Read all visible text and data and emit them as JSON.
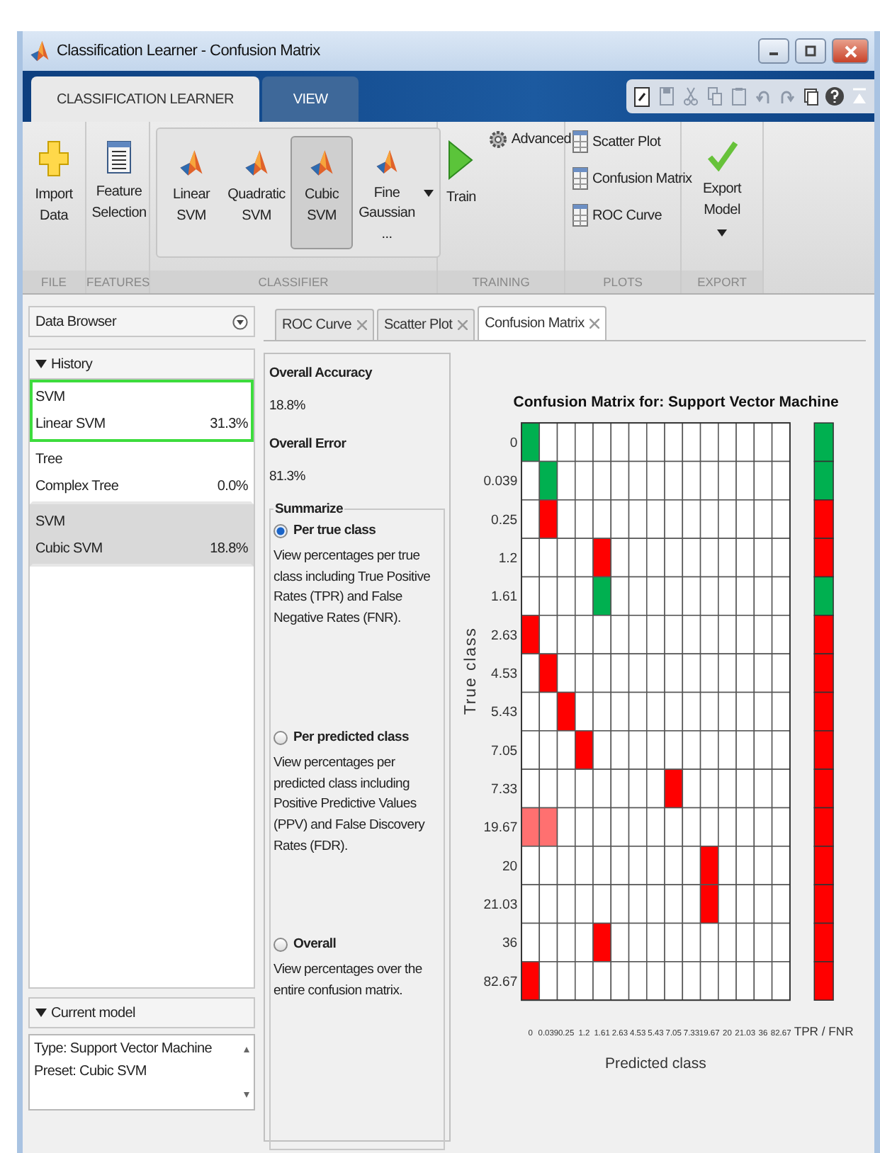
{
  "window": {
    "title": "Classification Learner - Confusion Matrix"
  },
  "ribbon_tabs": [
    {
      "label": "CLASSIFICATION LEARNER",
      "selected": true
    },
    {
      "label": "VIEW",
      "selected": false
    }
  ],
  "ribbon_sections": [
    {
      "label": "FILE",
      "kind": "large",
      "items": [
        {
          "kind": "import",
          "label": "Import Data"
        }
      ]
    },
    {
      "label": "FEATURES",
      "kind": "large",
      "items": [
        {
          "kind": "feature",
          "label": "Feature Selection"
        }
      ]
    },
    {
      "label": "CLASSIFIER",
      "kind": "gallery",
      "items": [
        {
          "kind": "model",
          "label": "Linear SVM",
          "selected": false
        },
        {
          "kind": "model",
          "label": "Quadratic SVM",
          "selected": false
        },
        {
          "kind": "model",
          "label": "Cubic SVM",
          "selected": true
        },
        {
          "kind": "model",
          "label": "Fine Gaussian ...",
          "selected": false
        }
      ]
    },
    {
      "label": "TRAINING",
      "kind": "training",
      "items": [
        {
          "kind": "train",
          "label": "Train"
        },
        {
          "kind": "advanced",
          "label": "Advanced"
        }
      ]
    },
    {
      "label": "PLOTS",
      "kind": "list",
      "items": [
        {
          "kind": "plot",
          "label": "Scatter Plot"
        },
        {
          "kind": "plot",
          "label": "Confusion Matrix"
        },
        {
          "kind": "plot",
          "label": "ROC Curve"
        }
      ]
    },
    {
      "label": "EXPORT",
      "kind": "large",
      "items": [
        {
          "kind": "export",
          "label": "Export Model"
        }
      ]
    }
  ],
  "data_browser": {
    "title": "Data Browser",
    "history": {
      "title": "History",
      "expanded": true,
      "items": [
        {
          "type": "SVM",
          "model": "Linear SVM",
          "accuracy": "31.3%",
          "selected": true,
          "current": false
        },
        {
          "type": "Tree",
          "model": "Complex Tree",
          "accuracy": "0.0%",
          "selected": false,
          "current": false
        },
        {
          "type": "SVM",
          "model": "Cubic SVM",
          "accuracy": "18.8%",
          "selected": false,
          "current": true
        }
      ]
    },
    "current_model": {
      "title": "Current model",
      "expanded": true,
      "lines": [
        "Type: Support Vector Machine",
        "Preset: Cubic SVM"
      ]
    }
  },
  "plot_tabs": [
    {
      "label": "ROC Curve",
      "selected": false
    },
    {
      "label": "Scatter Plot",
      "selected": false
    },
    {
      "label": "Confusion Matrix",
      "selected": true
    }
  ],
  "summary": {
    "accuracy_label": "Overall Accuracy",
    "accuracy": "18.8%",
    "error_label": "Overall Error",
    "error": "81.3%"
  },
  "summarize": {
    "title": "Summarize",
    "options": [
      {
        "label": "Per true class",
        "description": "View percentages per true class including True Positive Rates (TPR) and False Negative Rates (FNR).",
        "selected": true
      },
      {
        "label": "Per predicted class",
        "description": "View percentages per predicted class including Positive Predictive Values (PPV) and False Discovery Rates (FDR).",
        "selected": false
      },
      {
        "label": "Overall",
        "description": "View percentages over the entire confusion matrix.",
        "selected": false
      }
    ]
  },
  "confusion_matrix": {
    "title": "Confusion Matrix for: Support Vector Machine",
    "ylabel": "True class",
    "xlabel": "Predicted class",
    "summary_label": "TPR / FNR",
    "row_labels": [
      "0",
      "0.039",
      "0.25",
      "1.2",
      "1.61",
      "2.63",
      "4.53",
      "5.43",
      "7.05",
      "7.33",
      "19.67",
      "20",
      "21.03",
      "36",
      "82.67"
    ],
    "column_labels": [
      "0",
      "0.039",
      "0.25",
      "1.2",
      "1.61",
      "2.63",
      "4.53",
      "5.43",
      "7.05",
      "7.33",
      "19.67",
      "20",
      "21.03",
      "36",
      "82.67"
    ],
    "rows": [
      {
        "cells": [
          {
            "color": "#00b050"
          },
          {
            "color": "#ffffff"
          },
          {
            "color": "#ffffff"
          },
          {
            "color": "#ffffff"
          },
          {
            "color": "#ffffff"
          },
          {
            "color": "#ffffff"
          },
          {
            "color": "#ffffff"
          },
          {
            "color": "#ffffff"
          },
          {
            "color": "#ffffff"
          },
          {
            "color": "#ffffff"
          },
          {
            "color": "#ffffff"
          },
          {
            "color": "#ffffff"
          },
          {
            "color": "#ffffff"
          },
          {
            "color": "#ffffff"
          },
          {
            "color": "#ffffff"
          }
        ],
        "rate_cell": {
          "color": "#00b050"
        }
      },
      {
        "cells": [
          {
            "color": "#ffffff"
          },
          {
            "color": "#00b050"
          },
          {
            "color": "#ffffff"
          },
          {
            "color": "#ffffff"
          },
          {
            "color": "#ffffff"
          },
          {
            "color": "#ffffff"
          },
          {
            "color": "#ffffff"
          },
          {
            "color": "#ffffff"
          },
          {
            "color": "#ffffff"
          },
          {
            "color": "#ffffff"
          },
          {
            "color": "#ffffff"
          },
          {
            "color": "#ffffff"
          },
          {
            "color": "#ffffff"
          },
          {
            "color": "#ffffff"
          },
          {
            "color": "#ffffff"
          }
        ],
        "rate_cell": {
          "color": "#00b050"
        }
      },
      {
        "cells": [
          {
            "color": "#ffffff"
          },
          {
            "color": "#ff0000"
          },
          {
            "color": "#ffffff"
          },
          {
            "color": "#ffffff"
          },
          {
            "color": "#ffffff"
          },
          {
            "color": "#ffffff"
          },
          {
            "color": "#ffffff"
          },
          {
            "color": "#ffffff"
          },
          {
            "color": "#ffffff"
          },
          {
            "color": "#ffffff"
          },
          {
            "color": "#ffffff"
          },
          {
            "color": "#ffffff"
          },
          {
            "color": "#ffffff"
          },
          {
            "color": "#ffffff"
          },
          {
            "color": "#ffffff"
          }
        ],
        "rate_cell": {
          "color": "#ff0000"
        }
      },
      {
        "cells": [
          {
            "color": "#ffffff"
          },
          {
            "color": "#ffffff"
          },
          {
            "color": "#ffffff"
          },
          {
            "color": "#ffffff"
          },
          {
            "color": "#ff0000"
          },
          {
            "color": "#ffffff"
          },
          {
            "color": "#ffffff"
          },
          {
            "color": "#ffffff"
          },
          {
            "color": "#ffffff"
          },
          {
            "color": "#ffffff"
          },
          {
            "color": "#ffffff"
          },
          {
            "color": "#ffffff"
          },
          {
            "color": "#ffffff"
          },
          {
            "color": "#ffffff"
          },
          {
            "color": "#ffffff"
          }
        ],
        "rate_cell": {
          "color": "#ff0000"
        }
      },
      {
        "cells": [
          {
            "color": "#ffffff"
          },
          {
            "color": "#ffffff"
          },
          {
            "color": "#ffffff"
          },
          {
            "color": "#ffffff"
          },
          {
            "color": "#00b050"
          },
          {
            "color": "#ffffff"
          },
          {
            "color": "#ffffff"
          },
          {
            "color": "#ffffff"
          },
          {
            "color": "#ffffff"
          },
          {
            "color": "#ffffff"
          },
          {
            "color": "#ffffff"
          },
          {
            "color": "#ffffff"
          },
          {
            "color": "#ffffff"
          },
          {
            "color": "#ffffff"
          },
          {
            "color": "#ffffff"
          }
        ],
        "rate_cell": {
          "color": "#00b050"
        }
      },
      {
        "cells": [
          {
            "color": "#ff0000"
          },
          {
            "color": "#ffffff"
          },
          {
            "color": "#ffffff"
          },
          {
            "color": "#ffffff"
          },
          {
            "color": "#ffffff"
          },
          {
            "color": "#ffffff"
          },
          {
            "color": "#ffffff"
          },
          {
            "color": "#ffffff"
          },
          {
            "color": "#ffffff"
          },
          {
            "color": "#ffffff"
          },
          {
            "color": "#ffffff"
          },
          {
            "color": "#ffffff"
          },
          {
            "color": "#ffffff"
          },
          {
            "color": "#ffffff"
          },
          {
            "color": "#ffffff"
          }
        ],
        "rate_cell": {
          "color": "#ff0000"
        }
      },
      {
        "cells": [
          {
            "color": "#ffffff"
          },
          {
            "color": "#ff0000"
          },
          {
            "color": "#ffffff"
          },
          {
            "color": "#ffffff"
          },
          {
            "color": "#ffffff"
          },
          {
            "color": "#ffffff"
          },
          {
            "color": "#ffffff"
          },
          {
            "color": "#ffffff"
          },
          {
            "color": "#ffffff"
          },
          {
            "color": "#ffffff"
          },
          {
            "color": "#ffffff"
          },
          {
            "color": "#ffffff"
          },
          {
            "color": "#ffffff"
          },
          {
            "color": "#ffffff"
          },
          {
            "color": "#ffffff"
          }
        ],
        "rate_cell": {
          "color": "#ff0000"
        }
      },
      {
        "cells": [
          {
            "color": "#ffffff"
          },
          {
            "color": "#ffffff"
          },
          {
            "color": "#ff0000"
          },
          {
            "color": "#ffffff"
          },
          {
            "color": "#ffffff"
          },
          {
            "color": "#ffffff"
          },
          {
            "color": "#ffffff"
          },
          {
            "color": "#ffffff"
          },
          {
            "color": "#ffffff"
          },
          {
            "color": "#ffffff"
          },
          {
            "color": "#ffffff"
          },
          {
            "color": "#ffffff"
          },
          {
            "color": "#ffffff"
          },
          {
            "color": "#ffffff"
          },
          {
            "color": "#ffffff"
          }
        ],
        "rate_cell": {
          "color": "#ff0000"
        }
      },
      {
        "cells": [
          {
            "color": "#ffffff"
          },
          {
            "color": "#ffffff"
          },
          {
            "color": "#ffffff"
          },
          {
            "color": "#ff0000"
          },
          {
            "color": "#ffffff"
          },
          {
            "color": "#ffffff"
          },
          {
            "color": "#ffffff"
          },
          {
            "color": "#ffffff"
          },
          {
            "color": "#ffffff"
          },
          {
            "color": "#ffffff"
          },
          {
            "color": "#ffffff"
          },
          {
            "color": "#ffffff"
          },
          {
            "color": "#ffffff"
          },
          {
            "color": "#ffffff"
          },
          {
            "color": "#ffffff"
          }
        ],
        "rate_cell": {
          "color": "#ff0000"
        }
      },
      {
        "cells": [
          {
            "color": "#ffffff"
          },
          {
            "color": "#ffffff"
          },
          {
            "color": "#ffffff"
          },
          {
            "color": "#ffffff"
          },
          {
            "color": "#ffffff"
          },
          {
            "color": "#ffffff"
          },
          {
            "color": "#ffffff"
          },
          {
            "color": "#ffffff"
          },
          {
            "color": "#ff0000"
          },
          {
            "color": "#ffffff"
          },
          {
            "color": "#ffffff"
          },
          {
            "color": "#ffffff"
          },
          {
            "color": "#ffffff"
          },
          {
            "color": "#ffffff"
          },
          {
            "color": "#ffffff"
          }
        ],
        "rate_cell": {
          "color": "#ff0000"
        }
      },
      {
        "cells": [
          {
            "color": "#ff7070"
          },
          {
            "color": "#ff7070"
          },
          {
            "color": "#ffffff"
          },
          {
            "color": "#ffffff"
          },
          {
            "color": "#ffffff"
          },
          {
            "color": "#ffffff"
          },
          {
            "color": "#ffffff"
          },
          {
            "color": "#ffffff"
          },
          {
            "color": "#ffffff"
          },
          {
            "color": "#ffffff"
          },
          {
            "color": "#ffffff"
          },
          {
            "color": "#ffffff"
          },
          {
            "color": "#ffffff"
          },
          {
            "color": "#ffffff"
          },
          {
            "color": "#ffffff"
          }
        ],
        "rate_cell": {
          "color": "#ff0000"
        }
      },
      {
        "cells": [
          {
            "color": "#ffffff"
          },
          {
            "color": "#ffffff"
          },
          {
            "color": "#ffffff"
          },
          {
            "color": "#ffffff"
          },
          {
            "color": "#ffffff"
          },
          {
            "color": "#ffffff"
          },
          {
            "color": "#ffffff"
          },
          {
            "color": "#ffffff"
          },
          {
            "color": "#ffffff"
          },
          {
            "color": "#ffffff"
          },
          {
            "color": "#ff0000"
          },
          {
            "color": "#ffffff"
          },
          {
            "color": "#ffffff"
          },
          {
            "color": "#ffffff"
          },
          {
            "color": "#ffffff"
          }
        ],
        "rate_cell": {
          "color": "#ff0000"
        }
      },
      {
        "cells": [
          {
            "color": "#ffffff"
          },
          {
            "color": "#ffffff"
          },
          {
            "color": "#ffffff"
          },
          {
            "color": "#ffffff"
          },
          {
            "color": "#ffffff"
          },
          {
            "color": "#ffffff"
          },
          {
            "color": "#ffffff"
          },
          {
            "color": "#ffffff"
          },
          {
            "color": "#ffffff"
          },
          {
            "color": "#ffffff"
          },
          {
            "color": "#ff0000"
          },
          {
            "color": "#ffffff"
          },
          {
            "color": "#ffffff"
          },
          {
            "color": "#ffffff"
          },
          {
            "color": "#ffffff"
          }
        ],
        "rate_cell": {
          "color": "#ff0000"
        }
      },
      {
        "cells": [
          {
            "color": "#ffffff"
          },
          {
            "color": "#ffffff"
          },
          {
            "color": "#ffffff"
          },
          {
            "color": "#ffffff"
          },
          {
            "color": "#ff0000"
          },
          {
            "color": "#ffffff"
          },
          {
            "color": "#ffffff"
          },
          {
            "color": "#ffffff"
          },
          {
            "color": "#ffffff"
          },
          {
            "color": "#ffffff"
          },
          {
            "color": "#ffffff"
          },
          {
            "color": "#ffffff"
          },
          {
            "color": "#ffffff"
          },
          {
            "color": "#ffffff"
          },
          {
            "color": "#ffffff"
          }
        ],
        "rate_cell": {
          "color": "#ff0000"
        }
      },
      {
        "cells": [
          {
            "color": "#ff0000"
          },
          {
            "color": "#ffffff"
          },
          {
            "color": "#ffffff"
          },
          {
            "color": "#ffffff"
          },
          {
            "color": "#ffffff"
          },
          {
            "color": "#ffffff"
          },
          {
            "color": "#ffffff"
          },
          {
            "color": "#ffffff"
          },
          {
            "color": "#ffffff"
          },
          {
            "color": "#ffffff"
          },
          {
            "color": "#ffffff"
          },
          {
            "color": "#ffffff"
          },
          {
            "color": "#ffffff"
          },
          {
            "color": "#ffffff"
          },
          {
            "color": "#ffffff"
          }
        ],
        "rate_cell": {
          "color": "#ff0000"
        }
      }
    ]
  }
}
